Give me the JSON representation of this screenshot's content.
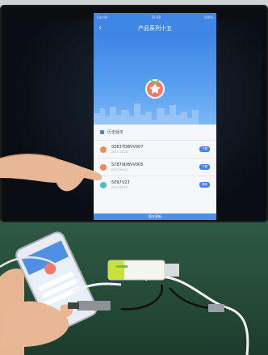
{
  "app": {
    "title": "产品系列十五",
    "status_left": "Carrier",
    "status_time": "16:48",
    "status_right": "100%",
    "history_label": "历史版本",
    "items": [
      {
        "title": "S3637DBVV007",
        "subtitle": "2017.12.22",
        "badge": "下载",
        "dot_color": "#f08a5d"
      },
      {
        "title": "S7879DBVV005",
        "subtitle": "2017.09.21",
        "badge": "下载",
        "dot_color": "#f08a5d"
      },
      {
        "title": "5097V23",
        "subtitle": "2017.08.15",
        "badge": "更新",
        "dot_color": "#3ec6c0"
      }
    ],
    "footer_label": "版本更新"
  }
}
